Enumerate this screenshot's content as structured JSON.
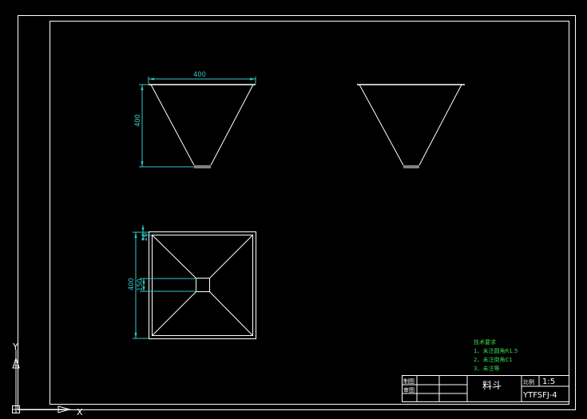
{
  "drawing": {
    "front_view": {
      "width_dim": "400",
      "height_dim": "400"
    },
    "top_view": {
      "overall_dim": "400",
      "top_offset_dim": "20",
      "outlet_dim": "150"
    }
  },
  "notes": {
    "title": "技术要求",
    "items": [
      "1、未注圆角R1.5",
      "2、未注倒角C1",
      "3、未注等"
    ]
  },
  "title_block": {
    "draw_label": "制图",
    "check_label": "审图",
    "part_name": "料斗",
    "scale_label": "比例",
    "scale_value": "1:5",
    "drawing_no": "YTFSFJ-4"
  },
  "ucs": {
    "y_label": "Y",
    "x_label": "X"
  },
  "colors": {
    "background": "#000000",
    "lines": "#ffffff",
    "dimensions": "#35c7c7",
    "notes": "#39d84c"
  }
}
